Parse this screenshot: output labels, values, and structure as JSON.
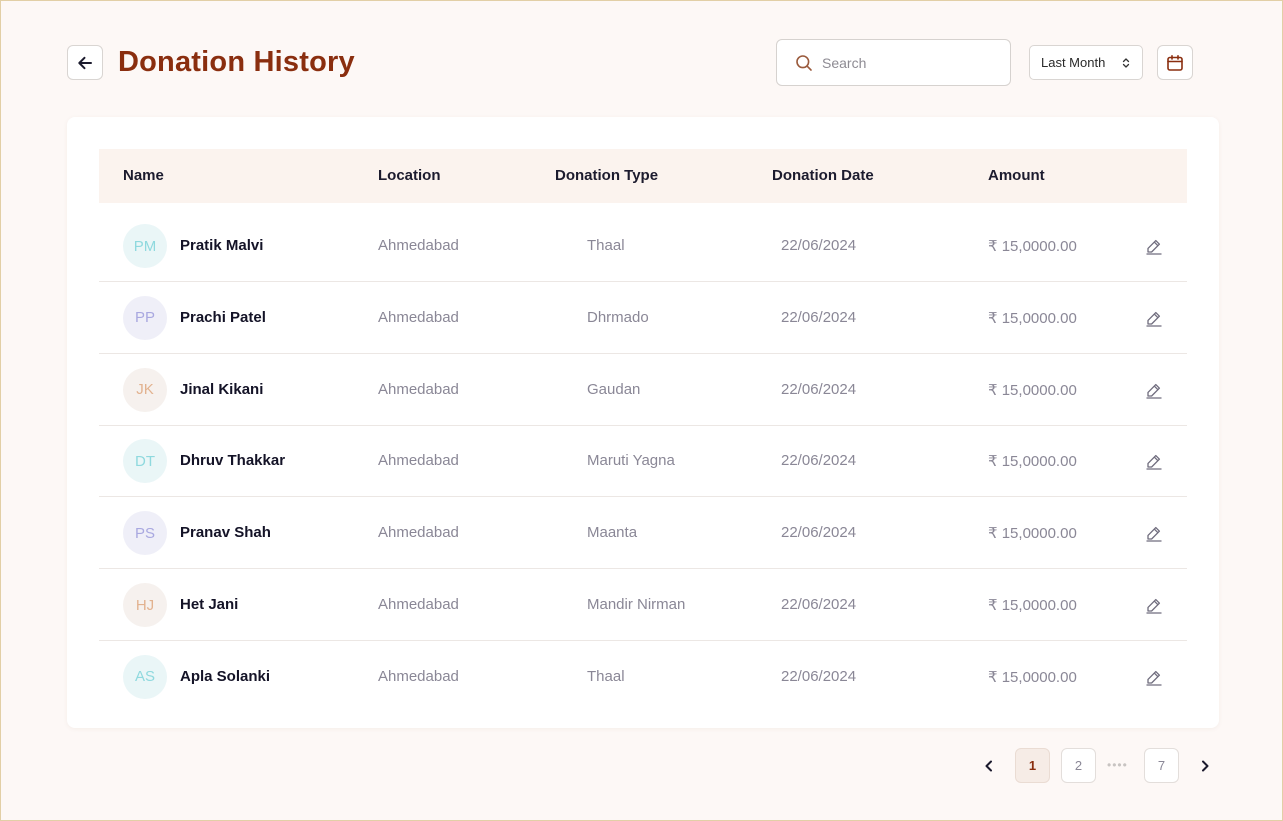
{
  "header": {
    "title": "Donation History",
    "search_placeholder": "Search",
    "period": "Last Month"
  },
  "table": {
    "columns": [
      "Name",
      "Location",
      "Donation Type",
      "Donation Date",
      "Amount"
    ],
    "rows": [
      {
        "initials": "PM",
        "name": "Pratik Malvi",
        "location": "Ahmedabad",
        "type": "Thaal",
        "date": "22/06/2024",
        "amount": "₹ 15,0000.00",
        "color": "#8fd9de",
        "bg": "#eaf6f7"
      },
      {
        "initials": "PP",
        "name": "Prachi Patel",
        "location": "Ahmedabad",
        "type": "Dhrmado",
        "date": "22/06/2024",
        "amount": "₹ 15,0000.00",
        "color": "#a9a8e0",
        "bg": "#efeff8"
      },
      {
        "initials": "JK",
        "name": "Jinal Kikani",
        "location": "Ahmedabad",
        "type": "Gaudan",
        "date": "22/06/2024",
        "amount": "₹ 15,0000.00",
        "color": "#e2b28f",
        "bg": "#f6f1ee"
      },
      {
        "initials": "DT",
        "name": "Dhruv Thakkar",
        "location": "Ahmedabad",
        "type": "Maruti Yagna",
        "date": "22/06/2024",
        "amount": "₹ 15,0000.00",
        "color": "#8fd9de",
        "bg": "#eaf6f7"
      },
      {
        "initials": "PS",
        "name": "Pranav Shah",
        "location": "Ahmedabad",
        "type": "Maanta",
        "date": "22/06/2024",
        "amount": "₹ 15,0000.00",
        "color": "#a9a8e0",
        "bg": "#efeff8"
      },
      {
        "initials": "HJ",
        "name": "Het Jani",
        "location": "Ahmedabad",
        "type": "Mandir Nirman",
        "date": "22/06/2024",
        "amount": "₹ 15,0000.00",
        "color": "#e2b28f",
        "bg": "#f6f1ee"
      },
      {
        "initials": "AS",
        "name": "Apla Solanki",
        "location": "Ahmedabad",
        "type": "Thaal",
        "date": "22/06/2024",
        "amount": "₹ 15,0000.00",
        "color": "#8fd9de",
        "bg": "#eaf6f7"
      }
    ]
  },
  "pagination": {
    "pages": [
      "1",
      "2",
      "7"
    ],
    "current": "1"
  },
  "icons": {
    "back": "arrow-left-icon",
    "search": "search-icon",
    "select": "chevron-up-down-icon",
    "calendar": "calendar-icon",
    "edit": "pencil-icon",
    "prev": "chevron-left-icon",
    "next": "chevron-right-icon"
  },
  "colors": {
    "brand": "#8a2e0f",
    "header_bg": "#fbf3ee",
    "page_bg": "#fdf8f6"
  }
}
